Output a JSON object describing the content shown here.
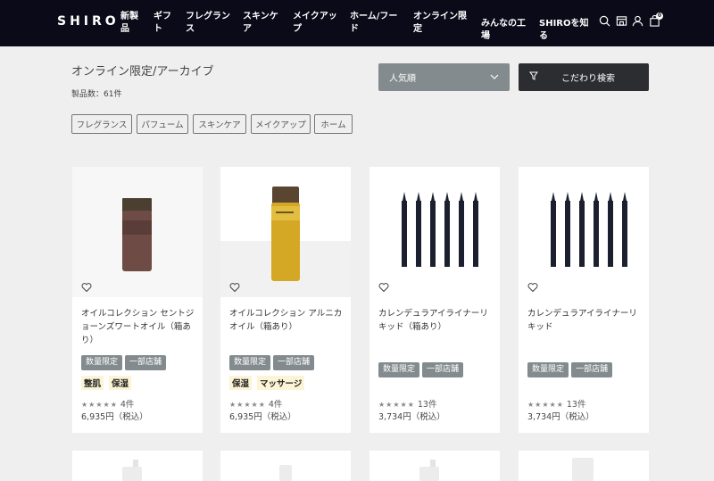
{
  "header": {
    "logo": "SHIRO",
    "nav": [
      {
        "line1": "新製",
        "line2": "品"
      },
      {
        "line1": "ギフ",
        "line2": "ト"
      },
      {
        "line1": "フレグラン",
        "line2": "ス"
      },
      {
        "line1": "スキンケ",
        "line2": "ア"
      },
      {
        "line1": "メイクアッ",
        "line2": "プ"
      },
      {
        "line1": "ホーム/フー",
        "line2": "ド"
      },
      {
        "line1": "オンライン限",
        "line2": "定"
      },
      {
        "line1": "",
        "line2": "みんなの工",
        "line3": "場"
      },
      {
        "line1": "",
        "line2": "SHIROを知",
        "line3": "る"
      }
    ],
    "cart_count": "0"
  },
  "page": {
    "title": "オンライン限定/アーカイブ",
    "count": "製品数：61件",
    "sort_label": "人気順",
    "filter_label": "こだわり検索",
    "tags": [
      "フレグランス",
      "パフューム",
      "スキンケア",
      "メイクアップ",
      "ホーム"
    ]
  },
  "products": [
    {
      "name": "オイルコレクション セントジョーンズワートオイル（箱あり）",
      "badges": [
        "数量限定",
        "一部店舗"
      ],
      "benefits": [
        "整肌",
        "保湿"
      ],
      "stars": "★★★★★",
      "reviews": "4件",
      "price": "6,935円（税込）"
    },
    {
      "name": "オイルコレクション アルニカオイル（箱あり）",
      "badges": [
        "数量限定",
        "一部店舗"
      ],
      "benefits": [
        "保湿",
        "マッサージ"
      ],
      "stars": "★★★★★",
      "reviews": "4件",
      "price": "6,935円（税込）"
    },
    {
      "name": "カレンデュラアイライナーリキッド（箱あり）",
      "badges": [
        "数量限定",
        "一部店舗"
      ],
      "benefits": [],
      "stars": "★★★★★",
      "reviews": "13件",
      "price": "3,734円（税込）"
    },
    {
      "name": "カレンデュラアイライナーリキッド",
      "badges": [
        "数量限定",
        "一部店舗"
      ],
      "benefits": [],
      "stars": "★★★★★",
      "reviews": "13件",
      "price": "3,734円（税込）"
    }
  ],
  "colors": {
    "header_bg": "#0a0a18",
    "badge_bg": "#838b8e",
    "filter_bg": "#2c2d31",
    "benefit_bg": "#fbf4d6"
  }
}
